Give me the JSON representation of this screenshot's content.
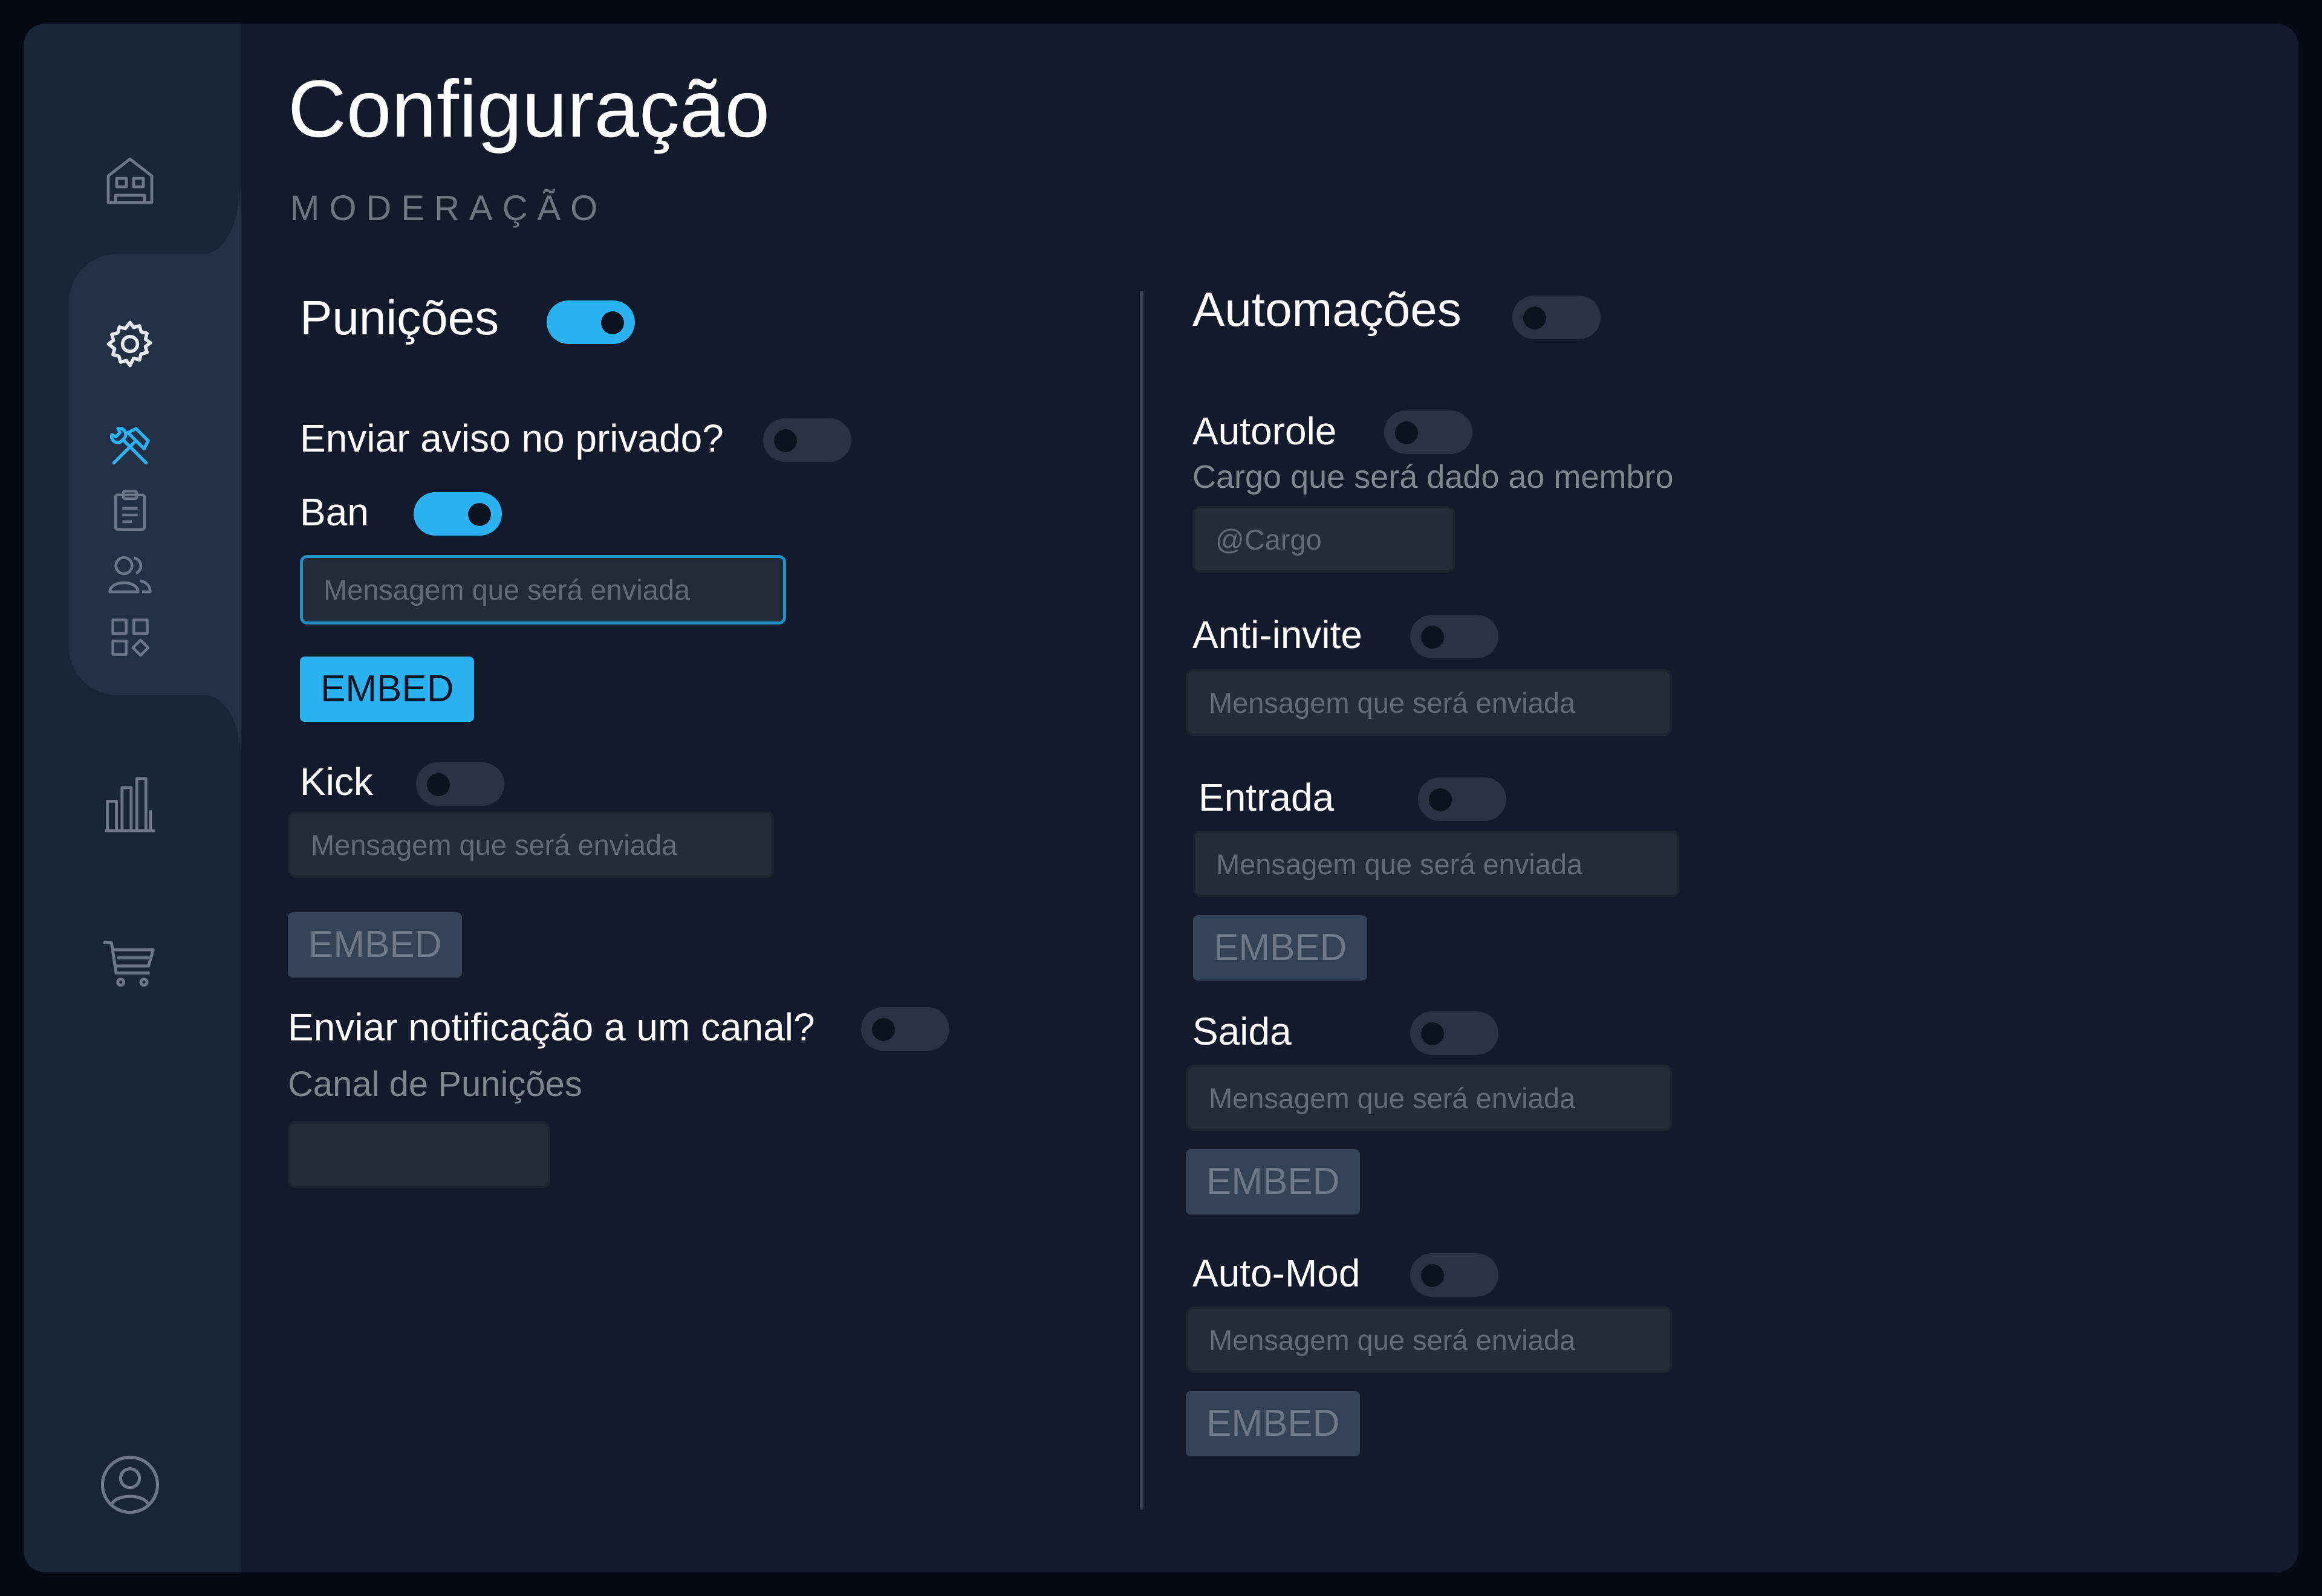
{
  "page": {
    "title": "Configuração",
    "subtitle": "MODERAÇÃO"
  },
  "sidebar": {
    "items": [
      {
        "icon": "home-icon"
      },
      {
        "icon": "gear-icon"
      },
      {
        "icon": "hammer-wrench-icon",
        "color": "#2ab3f0"
      },
      {
        "icon": "clipboard-icon"
      },
      {
        "icon": "users-icon"
      },
      {
        "icon": "apps-icon"
      },
      {
        "icon": "bar-chart-icon"
      },
      {
        "icon": "cart-icon"
      },
      {
        "icon": "profile-icon"
      }
    ],
    "accent": "#2ab3f0"
  },
  "left": {
    "title": "Punições",
    "enabled": true,
    "private_notice": {
      "label": "Enviar aviso no privado?",
      "enabled": false
    },
    "ban": {
      "label": "Ban",
      "enabled": true,
      "placeholder": "Mensagem que será enviada",
      "embed_label": "EMBED"
    },
    "kick": {
      "label": "Kick",
      "enabled": false,
      "placeholder": "Mensagem que será enviada",
      "embed_label": "EMBED"
    },
    "channel_notice": {
      "label": "Enviar notificação a um canal?",
      "enabled": false,
      "channel_label": "Canal de Punições",
      "channel_value": ""
    }
  },
  "right": {
    "title": "Automações",
    "enabled": false,
    "autorole": {
      "label": "Autorole",
      "enabled": false,
      "hint": "Cargo que será dado ao membro",
      "placeholder": "@Cargo"
    },
    "anti_invite": {
      "label": "Anti-invite",
      "enabled": false,
      "placeholder": "Mensagem que será enviada"
    },
    "entrada": {
      "label": "Entrada",
      "enabled": false,
      "placeholder": "Mensagem que será enviada",
      "embed_label": "EMBED"
    },
    "saida": {
      "label": "Saida",
      "enabled": false,
      "placeholder": "Mensagem que será enviada",
      "embed_label": "EMBED"
    },
    "auto_mod": {
      "label": "Auto-Mod",
      "enabled": false,
      "placeholder": "Mensagem que será enviada",
      "embed_label": "EMBED"
    }
  },
  "colors": {
    "background": "#121a2b",
    "sidebar": "#1a2537",
    "toggle_on": "#2ab3f0",
    "toggle_off": "#2a3344",
    "primary_button": "#2ab3f0",
    "disabled_button": "#354155"
  }
}
